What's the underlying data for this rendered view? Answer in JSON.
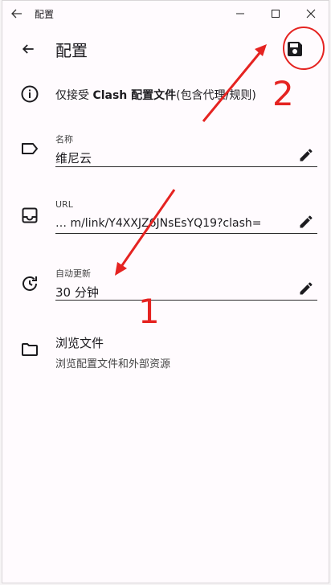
{
  "window": {
    "title": "配置"
  },
  "appbar": {
    "title": "配置"
  },
  "info": {
    "prefix": "仅接受 ",
    "bold": "Clash 配置文件",
    "suffix": "(包含代理/规则)"
  },
  "fields": {
    "name": {
      "label": "名称",
      "value": "维尼云"
    },
    "url": {
      "label": "URL",
      "value": "… m/link/Y4XXJZ6JNsEsYQ19?clash="
    },
    "auto_update": {
      "label": "自动更新",
      "value": "30 分钟"
    }
  },
  "browse": {
    "title": "浏览文件",
    "subtitle": "浏览配置文件和外部资源"
  },
  "annotations": {
    "one": "1",
    "two": "2",
    "color": "#e52321"
  },
  "icons": [
    "back-arrow-icon",
    "minimize-icon",
    "maximize-icon",
    "close-icon",
    "save-icon",
    "info-icon",
    "label-icon",
    "inbox-icon",
    "update-icon",
    "folder-icon",
    "pencil-icon"
  ]
}
